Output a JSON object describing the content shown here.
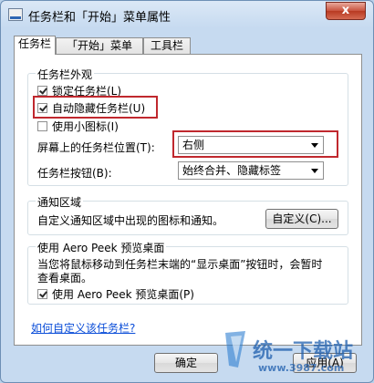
{
  "window": {
    "title": "任务栏和「开始」菜单属性",
    "close_label": "x"
  },
  "tabs": [
    {
      "label": "任务栏"
    },
    {
      "label": "「开始」菜单"
    },
    {
      "label": "工具栏"
    }
  ],
  "appearance": {
    "legend": "任务栏外观",
    "lock_taskbar": "锁定任务栏(L)",
    "auto_hide": "自动隐藏任务栏(U)",
    "small_icons": "使用小图标(I)",
    "position_label": "屏幕上的任务栏位置(T):",
    "position_value": "右侧",
    "buttons_label": "任务栏按钮(B):",
    "buttons_value": "始终合并、隐藏标签"
  },
  "notify": {
    "legend": "通知区域",
    "text": "自定义通知区域中出现的图标和通知。",
    "customize_button": "自定义(C)..."
  },
  "aero": {
    "legend": "使用 Aero Peek 预览桌面",
    "desc_line1": "当您将鼠标移动到任务栏末端的“显示桌面”按钮时，会暂时",
    "desc_line2": "查看桌面。",
    "checkbox": "使用 Aero Peek 预览桌面(P)"
  },
  "link": "如何自定义该任务栏?",
  "buttons": {
    "ok": "确定",
    "apply": "应用(A)"
  },
  "watermark": {
    "brand": "统一下载站",
    "url": "www.3987.com"
  }
}
